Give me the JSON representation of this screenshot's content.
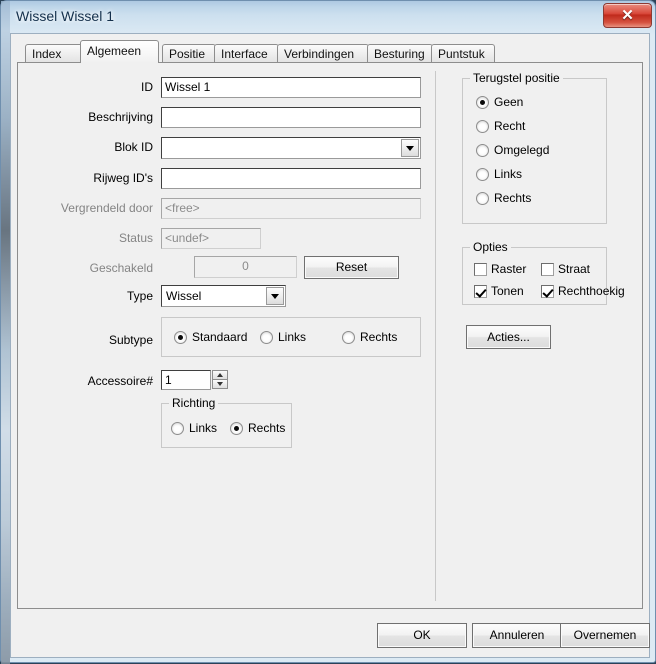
{
  "window": {
    "title": "Wissel Wissel 1",
    "close_label": "✕"
  },
  "tabs": [
    {
      "label": "Index",
      "selected": false
    },
    {
      "label": "Algemeen",
      "selected": true
    },
    {
      "label": "Positie",
      "selected": false
    },
    {
      "label": "Interface",
      "selected": false
    },
    {
      "label": "Verbindingen",
      "selected": false
    },
    {
      "label": "Besturing",
      "selected": false
    },
    {
      "label": "Puntstuk",
      "selected": false
    }
  ],
  "form": {
    "id": {
      "label": "ID",
      "value": "Wissel 1"
    },
    "beschrijving": {
      "label": "Beschrijving",
      "value": ""
    },
    "blok_id": {
      "label": "Blok ID",
      "value": ""
    },
    "rijweg_ids": {
      "label": "Rijweg ID's",
      "value": ""
    },
    "vergrendeld_door": {
      "label": "Vergrendeld door",
      "value": "<free>"
    },
    "status": {
      "label": "Status",
      "value": "<undef>"
    },
    "geschakeld": {
      "label": "Geschakeld",
      "value": "0"
    },
    "reset_button": "Reset",
    "type": {
      "label": "Type",
      "value": "Wissel"
    },
    "subtype": {
      "label": "Subtype",
      "options": [
        {
          "label": "Standaard",
          "selected": true
        },
        {
          "label": "Links",
          "selected": false
        },
        {
          "label": "Rechts",
          "selected": false
        }
      ]
    },
    "accessoire": {
      "label": "Accessoire#",
      "value": "1"
    },
    "richting": {
      "title": "Richting",
      "options": [
        {
          "label": "Links",
          "selected": false
        },
        {
          "label": "Rechts",
          "selected": true
        }
      ]
    }
  },
  "terugstel": {
    "title": "Terugstel positie",
    "options": [
      {
        "label": "Geen",
        "selected": true
      },
      {
        "label": "Recht",
        "selected": false
      },
      {
        "label": "Omgelegd",
        "selected": false
      },
      {
        "label": "Links",
        "selected": false
      },
      {
        "label": "Rechts",
        "selected": false
      }
    ]
  },
  "opties": {
    "title": "Opties",
    "items": [
      {
        "label": "Raster",
        "checked": false
      },
      {
        "label": "Straat",
        "checked": false
      },
      {
        "label": "Tonen",
        "checked": true
      },
      {
        "label": "Rechthoekig",
        "checked": true
      }
    ]
  },
  "acties_button": "Acties...",
  "footer": {
    "ok": "OK",
    "cancel": "Annuleren",
    "apply": "Overnemen"
  },
  "colors": {
    "accent": "#2b6cb0",
    "close_red": "#c02a1c",
    "window_bg": "#f0f0f0"
  }
}
